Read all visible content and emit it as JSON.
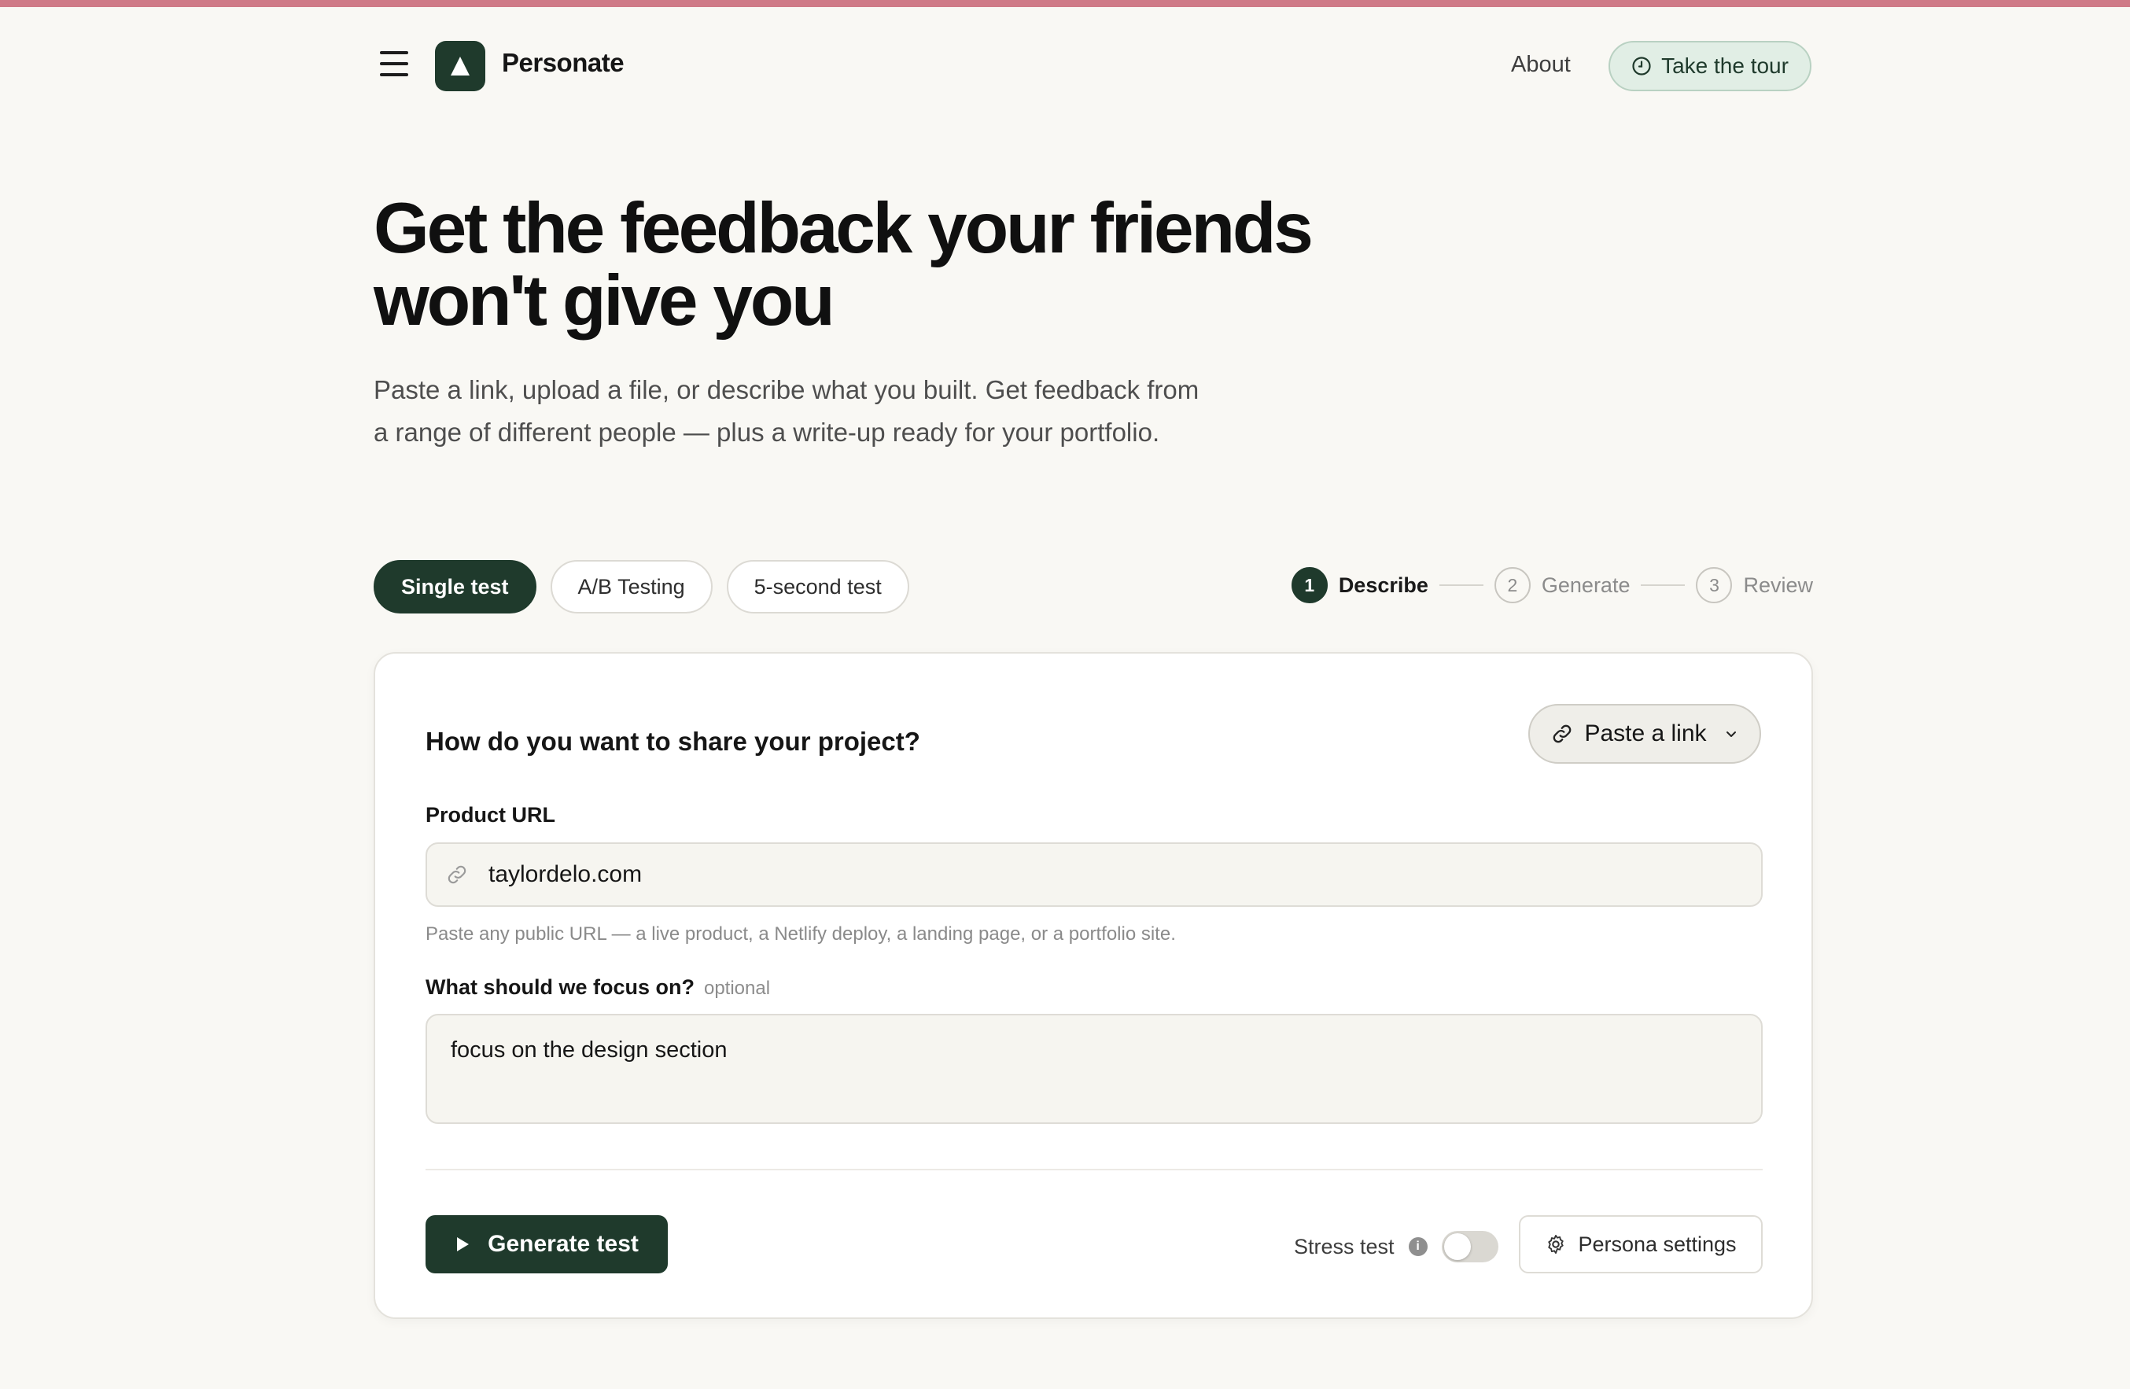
{
  "header": {
    "brand": "Personate",
    "about_label": "About",
    "tour_label": "Take the tour"
  },
  "hero": {
    "title_line1": "Get the feedback your friends",
    "title_line2": "won't give you",
    "subtitle": "Paste a link, upload a file, or describe what you built. Get feedback from a range of different people — plus a write-up ready for your portfolio."
  },
  "tabs": [
    {
      "label": "Single test",
      "active": true
    },
    {
      "label": "A/B Testing",
      "active": false
    },
    {
      "label": "5-second test",
      "active": false
    }
  ],
  "stepper": [
    {
      "num": "1",
      "label": "Describe",
      "active": true
    },
    {
      "num": "2",
      "label": "Generate",
      "active": false
    },
    {
      "num": "3",
      "label": "Review",
      "active": false
    }
  ],
  "card": {
    "question": "How do you want to share your project?",
    "share_mode": "Paste a link",
    "url_label": "Product URL",
    "url_value": "taylordelo.com",
    "url_hint": "Paste any public URL — a live product, a Netlify deploy, a landing page, or a portfolio site.",
    "focus_label": "What should we focus on?",
    "focus_optional": "optional",
    "focus_value": "focus on the design section",
    "generate_label": "Generate test",
    "stress_label": "Stress test",
    "stress_enabled": false,
    "persona_label": "Persona settings"
  },
  "colors": {
    "accent": "#1f3a2c",
    "top_bar": "#cf7a87",
    "background": "#f9f8f4"
  },
  "icons": {
    "menu": "menu-icon",
    "logo": "triangle-logo-icon",
    "tour": "clock-icon",
    "link": "link-icon",
    "chevron": "chevron-down-icon",
    "play": "play-icon",
    "info": "info-icon",
    "gear": "gear-icon"
  }
}
